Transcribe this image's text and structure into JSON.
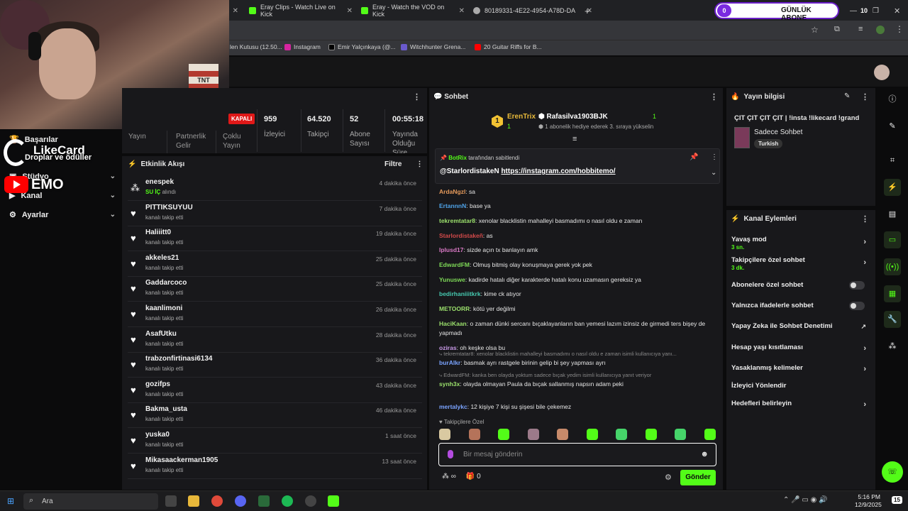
{
  "browser": {
    "tabs": [
      {
        "label": "Eray Clips - Watch Live on Kick"
      },
      {
        "label": "Eray - Watch the VOD on Kick"
      },
      {
        "label": "80189331-4E22-4954-A78D-DA"
      }
    ],
    "bookmarks": [
      "len Kutusu (12.50...",
      "Instagram",
      "Emir Yalçınkaya (@...",
      "Witchhunter Grena...",
      "20 Guitar Riffs for B..."
    ]
  },
  "overlay": {
    "abone_count": "0",
    "abone_label": "GÜNLÜK ABONE",
    "abone_right": "10",
    "likecard_title": "LikeCard",
    "likecard_sub": "Droplar ve ödüller",
    "emo": "EMO",
    "tnt": "TNT"
  },
  "sidebar": {
    "items": [
      {
        "label": "Başarılar"
      },
      {
        "label": "Stüdyo"
      },
      {
        "label": "Kanal"
      },
      {
        "label": "Ayarlar"
      }
    ]
  },
  "stats": {
    "status": "KAPALI",
    "items": [
      {
        "value": "959",
        "label": "İzleyici"
      },
      {
        "value": "64.520",
        "label": "Takipçi"
      },
      {
        "value": "52",
        "label": "Abone Sayısı"
      },
      {
        "value": "00:55:18",
        "label": "Yayında Olduğu Süre"
      }
    ],
    "tabs": [
      "Yayın",
      "Partnerlik Gelir",
      "Çoklu Yayın"
    ]
  },
  "activity": {
    "title": "Etkinlik Akışı",
    "filter": "Filtre",
    "rows": [
      {
        "name": "enespek",
        "desc_hl": "SU İÇ",
        "desc": "alındı",
        "time": "4 dakika önce"
      },
      {
        "name": "PITTIKSUYUU",
        "desc": "kanalı takip etti",
        "time": "7 dakika önce"
      },
      {
        "name": "Haliiitt0",
        "desc": "kanalı takip etti",
        "time": "19 dakika önce"
      },
      {
        "name": "akkeles21",
        "desc": "kanalı takip etti",
        "time": "25 dakika önce"
      },
      {
        "name": "Gaddarcoco",
        "desc": "kanalı takip etti",
        "time": "25 dakika önce"
      },
      {
        "name": "kaanlimoni",
        "desc": "kanalı takip etti",
        "time": "26 dakika önce"
      },
      {
        "name": "AsafUtku",
        "desc": "kanalı takip etti",
        "time": "28 dakika önce"
      },
      {
        "name": "trabzonfirtinasi6134",
        "desc": "kanalı takip etti",
        "time": "36 dakika önce"
      },
      {
        "name": "gozifps",
        "desc": "kanalı takip etti",
        "time": "43 dakika önce"
      },
      {
        "name": "Bakma_usta",
        "desc": "kanalı takip etti",
        "time": "46 dakika önce"
      },
      {
        "name": "yuska0",
        "desc": "kanalı takip etti",
        "time": "1 saat önce"
      },
      {
        "name": "Mikasaackerman1905",
        "desc": "kanalı takip etti",
        "time": "13 saat önce"
      }
    ]
  },
  "chat": {
    "title": "Sohbet",
    "gifter1": "ErenTrix",
    "gifter1_count": "1",
    "gifter2": "Rafasilva1903BJK",
    "gifter2_count": "1",
    "gifter_note": "1 abonelik hediye ederek 3. sıraya yükselin",
    "pinned_by": "BotRix",
    "pinned_label": "tarafından sabitlendi",
    "pinned_user": "@StarlordistakeN",
    "pinned_link": "https://instagram.com/hobbitemo/",
    "messages": [
      {
        "user": "ArdaNgzl",
        "color": "#e59a5b",
        "text": "sa"
      },
      {
        "user": "ErtannnN",
        "color": "#4fa3e8",
        "text": "base ya"
      },
      {
        "user": "tekremtatar8",
        "color": "#9be06c",
        "text": "xenolar blacklistin mahalleyi basmadımı o nasıl oldu e zaman"
      },
      {
        "user": "Starlordistakeñ",
        "color": "#d34a4a",
        "text": "as"
      },
      {
        "user": "Iplusd17",
        "color": "#d979c5",
        "text": "sizde açın tx banlayın amk"
      },
      {
        "user": "EdwardFM",
        "color": "#7ed957",
        "text": "Olmuş bitmiş olay konuşmaya gerek yok pek"
      },
      {
        "user": "Yunuswe",
        "color": "#7ed957",
        "text": "kadirde hatalı diğer karakterde hatalı konu uzamasın gereksiz ya"
      },
      {
        "user": "bedirhaniiitkrk",
        "color": "#46c9b0",
        "text": "kime ck atıyor"
      },
      {
        "user": "METOORR",
        "color": "#9be06c",
        "text": "kötü yer değilmi"
      },
      {
        "user": "HaciKaan",
        "color": "#9be06c",
        "text": "o zaman dünki sercanı bıçaklayanların ban yemesi lazım izinsiz de girmedi ters bişey de yapmadı"
      },
      {
        "user": "oziras",
        "color": "#c99ae8",
        "text": "oh keşke olsa bu"
      },
      {
        "reply": "tekremtatar8: xenolar blacklistin mahalleyi basmadımı o nasıl oldu e zaman isimli kullanıcıya yanı...",
        "user": "burAlkr",
        "color": "#7aa3ff",
        "text": "basmak ayrı rastgele birinin gelip bi şey yapması ayrı"
      },
      {
        "reply": "EdwardFM: kanka ben olayda yoktum sadece bıçak yedim isimli kullanıcıya yanıt veriyor",
        "user": "synh3x",
        "color": "#9be06c",
        "text": "olayda olmayan Paula da bıçak sallanmış napsın adam peki"
      },
      {
        "user": "mertalykc",
        "color": "#7aa3ff",
        "text": "12 kişiye 7 kişi su şişesi bile çekemez"
      }
    ],
    "follower_only": "Takipçilere Özel",
    "input_placeholder": "Bir mesaj gönderin",
    "bottom_count": "0",
    "send": "Gönder"
  },
  "info": {
    "title": "Yayın bilgisi",
    "stream_title": "ÇIT ÇIT ÇIT ÇIT | !insta !likecard !grand",
    "category": "Sadece Sohbet",
    "language": "Turkish"
  },
  "actions": {
    "title": "Kanal Eylemleri",
    "items": [
      {
        "label": "Yavaş mod",
        "sub": "3 sn."
      },
      {
        "label": "Takipçilere özel sohbet",
        "sub": "3 dk."
      },
      {
        "label": "Abonelere özel sohbet"
      },
      {
        "label": "Yalnızca ifadelerle sohbet"
      },
      {
        "label": "Yapay Zeka ile Sohbet Denetimi"
      },
      {
        "label": "Hesap yaşı kısıtlaması"
      },
      {
        "label": "Yasaklanmış kelimeler"
      },
      {
        "label": "İzleyici Yönlendir"
      },
      {
        "label": "Hedefleri belirleyin"
      }
    ]
  },
  "taskbar": {
    "search": "Ara",
    "time": "5:16 PM",
    "date": "12/9/2025",
    "badge": "15"
  },
  "colors": {
    "accent": "#53fc18",
    "panel": "#18181b",
    "bg": "#0b0b0c"
  }
}
